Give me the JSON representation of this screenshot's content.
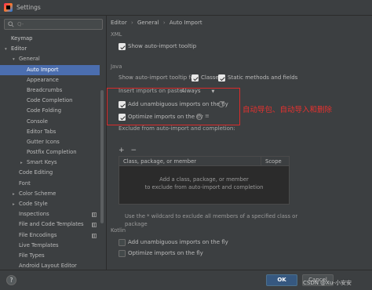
{
  "window": {
    "title": "Settings"
  },
  "search": {
    "placeholder": "Q-"
  },
  "tree": [
    {
      "label": "Keymap",
      "level": 0,
      "arrow": "",
      "bold": true
    },
    {
      "label": "Editor",
      "level": 0,
      "arrow": "▾",
      "bold": true
    },
    {
      "label": "General",
      "level": 1,
      "arrow": "▾"
    },
    {
      "label": "Auto Import",
      "level": 2,
      "arrow": "",
      "selected": true
    },
    {
      "label": "Appearance",
      "level": 2,
      "arrow": ""
    },
    {
      "label": "Breadcrumbs",
      "level": 2,
      "arrow": ""
    },
    {
      "label": "Code Completion",
      "level": 2,
      "arrow": ""
    },
    {
      "label": "Code Folding",
      "level": 2,
      "arrow": ""
    },
    {
      "label": "Console",
      "level": 2,
      "arrow": ""
    },
    {
      "label": "Editor Tabs",
      "level": 2,
      "arrow": ""
    },
    {
      "label": "Gutter Icons",
      "level": 2,
      "arrow": ""
    },
    {
      "label": "Postfix Completion",
      "level": 2,
      "arrow": ""
    },
    {
      "label": "Smart Keys",
      "level": 2,
      "arrow": "▸"
    },
    {
      "label": "Code Editing",
      "level": 1,
      "arrow": ""
    },
    {
      "label": "Font",
      "level": 1,
      "arrow": ""
    },
    {
      "label": "Color Scheme",
      "level": 1,
      "arrow": "▸"
    },
    {
      "label": "Code Style",
      "level": 1,
      "arrow": "▸"
    },
    {
      "label": "Inspections",
      "level": 1,
      "arrow": "",
      "proj": true
    },
    {
      "label": "File and Code Templates",
      "level": 1,
      "arrow": "",
      "proj": true
    },
    {
      "label": "File Encodings",
      "level": 1,
      "arrow": "",
      "proj": true
    },
    {
      "label": "Live Templates",
      "level": 1,
      "arrow": ""
    },
    {
      "label": "File Types",
      "level": 1,
      "arrow": ""
    },
    {
      "label": "Android Layout Editor",
      "level": 1,
      "arrow": ""
    }
  ],
  "breadcrumb": {
    "part1": "Editor",
    "sep": "›",
    "part2": "General",
    "part3": "Auto Import"
  },
  "xml": {
    "section": "XML",
    "show_tooltip": "Show auto-import tooltip"
  },
  "java": {
    "section": "Java",
    "show_tooltip_for": "Show auto-import tooltip for:",
    "classes": "Classes",
    "static_methods": "Static methods and fields",
    "insert_on_paste": "Insert imports on paste:",
    "insert_value": "Always",
    "add_unambiguous": "Add unambiguous imports on the fly",
    "optimize": "Optimize imports on the fly",
    "exclude_label": "Exclude from auto-import and completion:",
    "add_symbol": "+",
    "remove_symbol": "−",
    "col_class": "Class, package, or member",
    "col_scope": "Scope",
    "empty_line1": "Add a class, package, or member",
    "empty_line2": "to exclude from auto-import and completion",
    "note": "Use the * wildcard to exclude all members of a specified class or package"
  },
  "kotlin": {
    "section": "Kotlin",
    "add_unambiguous": "Add unambiguous imports on the fly",
    "optimize": "Optimize imports on the fly"
  },
  "annotation": {
    "text": "自动导包、自动导入和删除",
    "color": "#e8312f"
  },
  "buttons": {
    "help": "?",
    "ok": "OK",
    "cancel": "Cancel"
  },
  "watermark": "CSDN @Xu-小安安",
  "colors": {
    "accent": "#4b6eaf",
    "primary_button": "#365880",
    "annotation_red": "#d92b2b"
  }
}
